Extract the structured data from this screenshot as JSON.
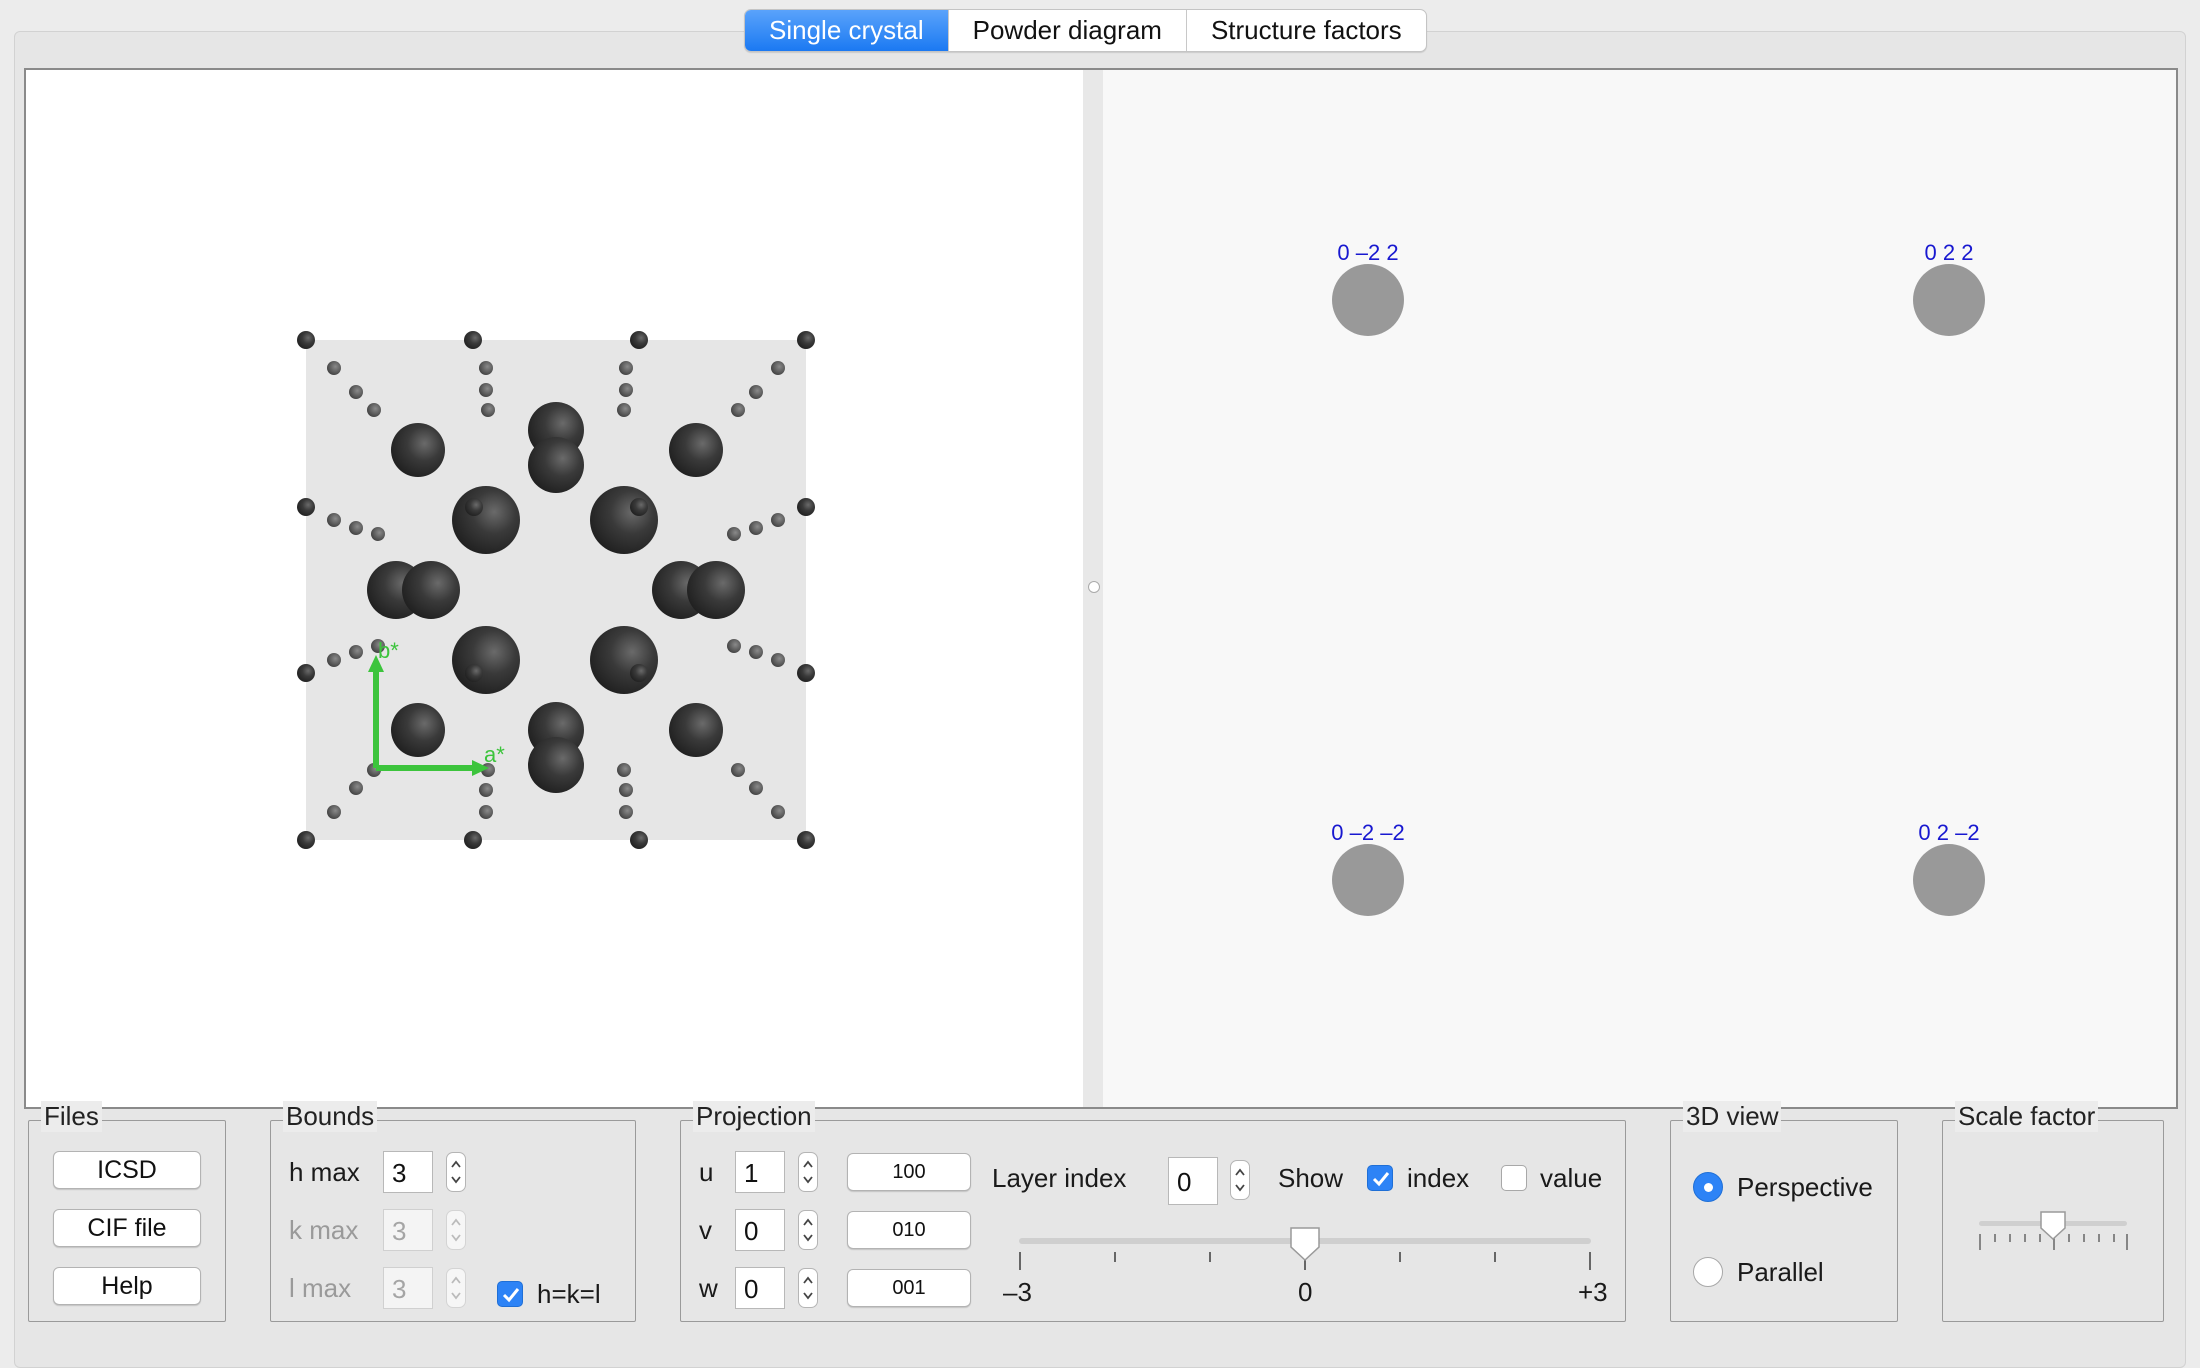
{
  "tabs": [
    {
      "label": "Single crystal",
      "active": true
    },
    {
      "label": "Powder diagram",
      "active": false
    },
    {
      "label": "Structure factors",
      "active": false
    }
  ],
  "view3d": {
    "axes": {
      "b_label": "b*",
      "a_label": "a*",
      "axis_color": "#3cc43c"
    },
    "colors": {
      "cell_background": "#e6e6e6",
      "atom_color": "#333333"
    }
  },
  "reflections": [
    {
      "label": "0 –2 2"
    },
    {
      "label": "0 2 2"
    },
    {
      "label": "0 –2 –2"
    },
    {
      "label": "0 2 –2"
    }
  ],
  "reflection_colors": {
    "label": "#1818d0",
    "spot": "#999999"
  },
  "files": {
    "title": "Files",
    "icsd_label": "ICSD",
    "cif_label": "CIF file",
    "help_label": "Help"
  },
  "bounds": {
    "title": "Bounds",
    "h_label": "h max",
    "h_value": "3",
    "k_label": "k max",
    "k_value": "3",
    "l_label": "l max",
    "l_value": "3",
    "hkl_equal_label": "h=k=l",
    "hkl_equal_checked": true
  },
  "projection": {
    "title": "Projection",
    "u_label": "u",
    "u_value": "1",
    "u_vector": "100",
    "v_label": "v",
    "v_value": "0",
    "v_vector": "010",
    "w_label": "w",
    "w_value": "0",
    "w_vector": "001",
    "layer_label": "Layer index",
    "layer_value": "0",
    "show_label": "Show",
    "index_label": "index",
    "index_checked": true,
    "value_label": "value",
    "value_checked": false,
    "slider_min_label": "–3",
    "slider_mid_label": "0",
    "slider_max_label": "+3",
    "slider_value": 0
  },
  "view3d_mode": {
    "title": "3D view",
    "perspective_label": "Perspective",
    "parallel_label": "Parallel",
    "selected": "Perspective"
  },
  "scale": {
    "title": "Scale factor",
    "value_fraction": 0.5
  },
  "accent_color": "#2d83f6"
}
